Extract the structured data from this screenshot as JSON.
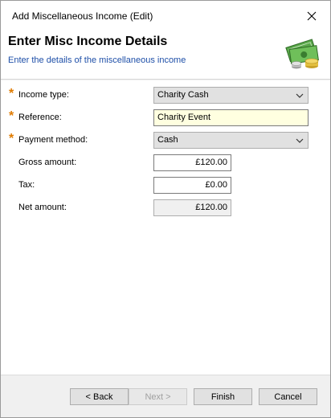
{
  "window": {
    "title": "Add Miscellaneous Income (Edit)"
  },
  "header": {
    "title": "Enter Misc Income Details",
    "subtitle": "Enter the details of the miscellaneous income",
    "icon": "money-cash-icon"
  },
  "form": {
    "income_type": {
      "label": "Income type:",
      "value": "Charity Cash",
      "required": "*"
    },
    "reference": {
      "label": "Reference:",
      "value": "Charity Event",
      "required": "*"
    },
    "payment_method": {
      "label": "Payment method:",
      "value": "Cash",
      "required": "*"
    },
    "gross_amount": {
      "label": "Gross amount:",
      "value": "£120.00"
    },
    "tax": {
      "label": "Tax:",
      "value": "£0.00"
    },
    "net_amount": {
      "label": "Net amount:",
      "value": "£120.00"
    }
  },
  "buttons": {
    "back": "< Back",
    "next": "Next >",
    "finish": "Finish",
    "cancel": "Cancel"
  },
  "colors": {
    "required": "#e07b00",
    "subtitle": "#1e4fa8",
    "highlight_field": "#ffffe0"
  }
}
